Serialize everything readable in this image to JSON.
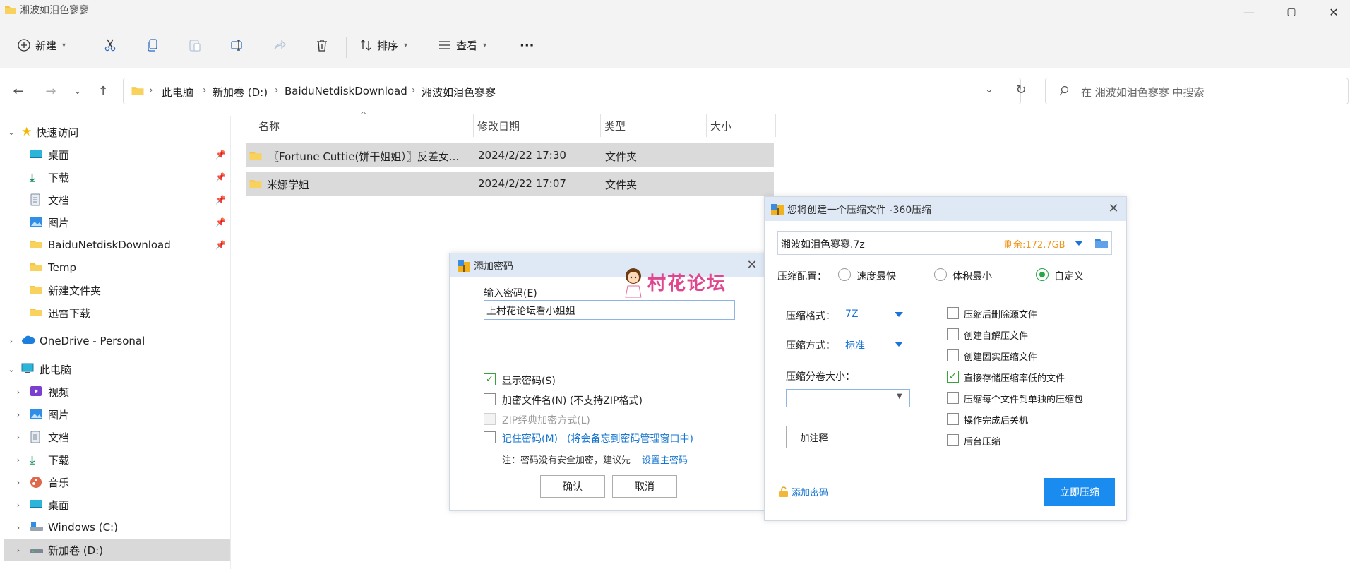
{
  "window": {
    "title": "湘波如泪色寥寥",
    "controls": {
      "minimize": "—",
      "maximize": "▢",
      "close": "✕"
    }
  },
  "toolbar": {
    "new_label": "新建",
    "sort_label": "排序",
    "view_label": "查看",
    "more_label": "···"
  },
  "address": {
    "crumbs": [
      "此电脑",
      "新加卷 (D:)",
      "BaiduNetdiskDownload",
      "湘波如泪色寥寥"
    ],
    "search_placeholder": "在 湘波如泪色寥寥 中搜索"
  },
  "sidebar": {
    "quick_access": "快速访问",
    "quick_items": [
      "桌面",
      "下载",
      "文档",
      "图片",
      "BaiduNetdiskDownload",
      "Temp",
      "新建文件夹",
      "迅雷下载"
    ],
    "onedrive": "OneDrive - Personal",
    "this_pc": "此电脑",
    "pc_items": [
      "视频",
      "图片",
      "文档",
      "下载",
      "音乐",
      "桌面",
      "Windows (C:)",
      "新加卷 (D:)"
    ]
  },
  "filelist": {
    "columns": {
      "name": "名称",
      "date": "修改日期",
      "type": "类型",
      "size": "大小"
    },
    "rows": [
      {
        "name": "〖Fortune Cuttie(饼干姐姐）〗反差女...",
        "date": "2024/2/22 17:30",
        "type": "文件夹"
      },
      {
        "name": "米娜学姐",
        "date": "2024/2/22 17:07",
        "type": "文件夹"
      }
    ]
  },
  "password_dialog": {
    "title": "添加密码",
    "input_label": "输入密码(E)",
    "input_value": "上村花论坛看小姐姐",
    "watermark": "村花论坛",
    "show_password": "显示密码(S)",
    "encrypt_names": "加密文件名(N) (不支持ZIP格式)",
    "zip_classic": "ZIP经典加密方式(L)",
    "remember_a": "记住密码(M)",
    "remember_b": "(将会备忘到密码管理窗口中)",
    "note_prefix": "注：密码没有安全加密，建议先",
    "note_link": "设置主密码",
    "ok": "确认",
    "cancel": "取消"
  },
  "compress_dialog": {
    "title": "您将创建一个压缩文件 -360压缩",
    "filename": "湘波如泪色寥寥.7z",
    "remaining": "剩余:172.7GB",
    "config_label": "压缩配置：",
    "options": [
      "速度最快",
      "体积最小",
      "自定义"
    ],
    "format_label": "压缩格式：",
    "format_value": "7Z",
    "method_label": "压缩方式：",
    "method_value": "标准",
    "split_label": "压缩分卷大小：",
    "comment_btn": "加注释",
    "checkboxes": [
      "压缩后删除源文件",
      "创建自解压文件",
      "创建固实压缩文件",
      "直接存储压缩率低的文件",
      "压缩每个文件到单独的压缩包",
      "操作完成后关机",
      "后台压缩"
    ],
    "add_password": "添加密码",
    "compress_now": "立即压缩",
    "accent": "#1a8cf0"
  }
}
